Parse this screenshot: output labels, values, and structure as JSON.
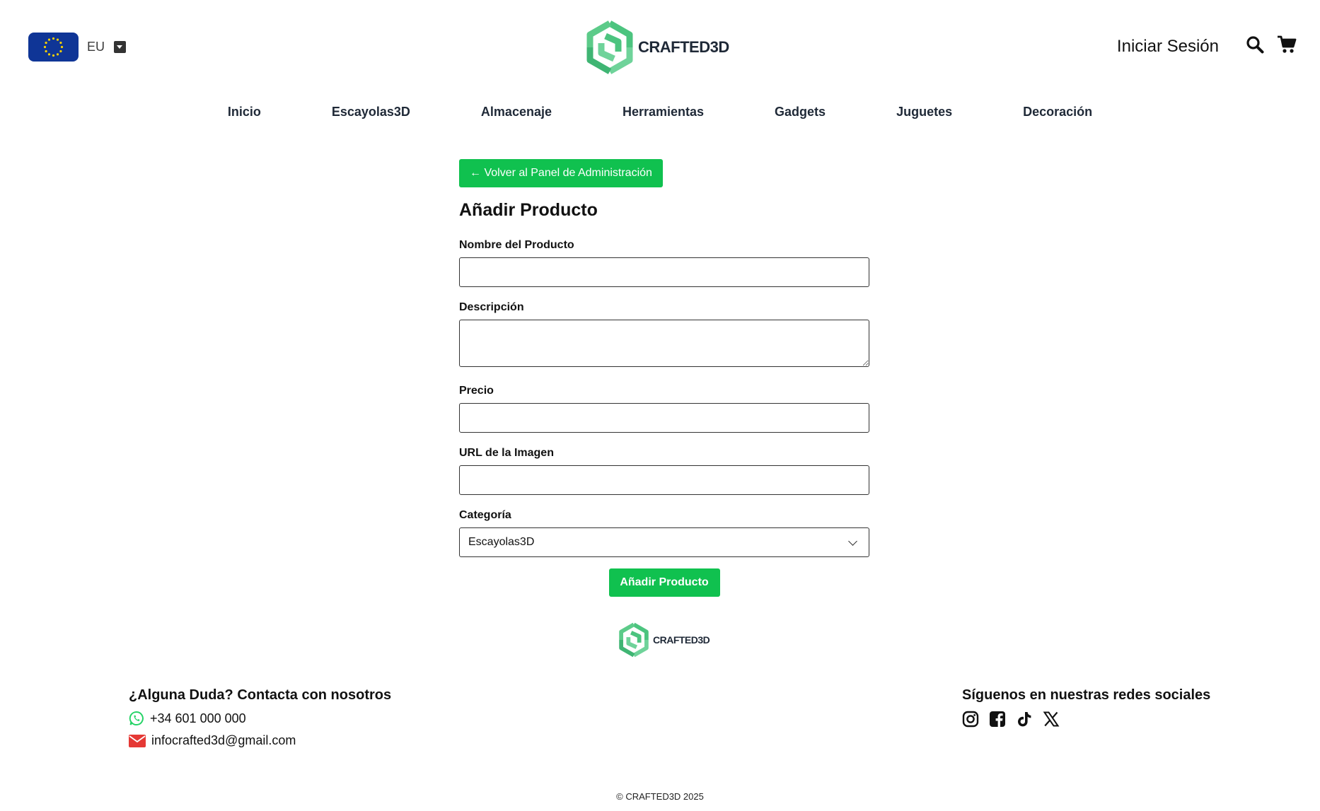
{
  "header": {
    "language_code": "EU",
    "logo_text": "CRAFTED3D",
    "login_label": "Iniciar Sesión"
  },
  "nav": {
    "items": [
      "Inicio",
      "Escayolas3D",
      "Almacenaje",
      "Herramientas",
      "Gadgets",
      "Juguetes",
      "Decoración"
    ]
  },
  "form": {
    "back_label": "← Volver al Panel de Administración",
    "title": "Añadir Producto",
    "fields": {
      "name": {
        "label": "Nombre del Producto",
        "value": ""
      },
      "description": {
        "label": "Descripción",
        "value": ""
      },
      "price": {
        "label": "Precio",
        "value": ""
      },
      "image_url": {
        "label": "URL de la Imagen",
        "value": ""
      },
      "category": {
        "label": "Categoría",
        "value": "Escayolas3D"
      }
    },
    "submit_label": "Añadir Producto"
  },
  "footer": {
    "logo_text": "CRAFTED3D",
    "contact_title": "¿Alguna Duda? Contacta con nosotros",
    "phone": "+34 601 000 000",
    "email": "infocrafted3d@gmail.com",
    "social_title": "Síguenos en nuestras redes sociales",
    "social_icons": [
      "instagram-icon",
      "facebook-icon",
      "tiktok-icon",
      "x-icon"
    ],
    "copyright": "© CRAFTED3D 2025"
  },
  "colors": {
    "accent_green": "#10c14f",
    "logo_green": "#4cc47f",
    "flag_blue": "#0f3596",
    "flag_star": "#f5d000",
    "whatsapp_green": "#25d366",
    "email_red": "#e53935"
  }
}
